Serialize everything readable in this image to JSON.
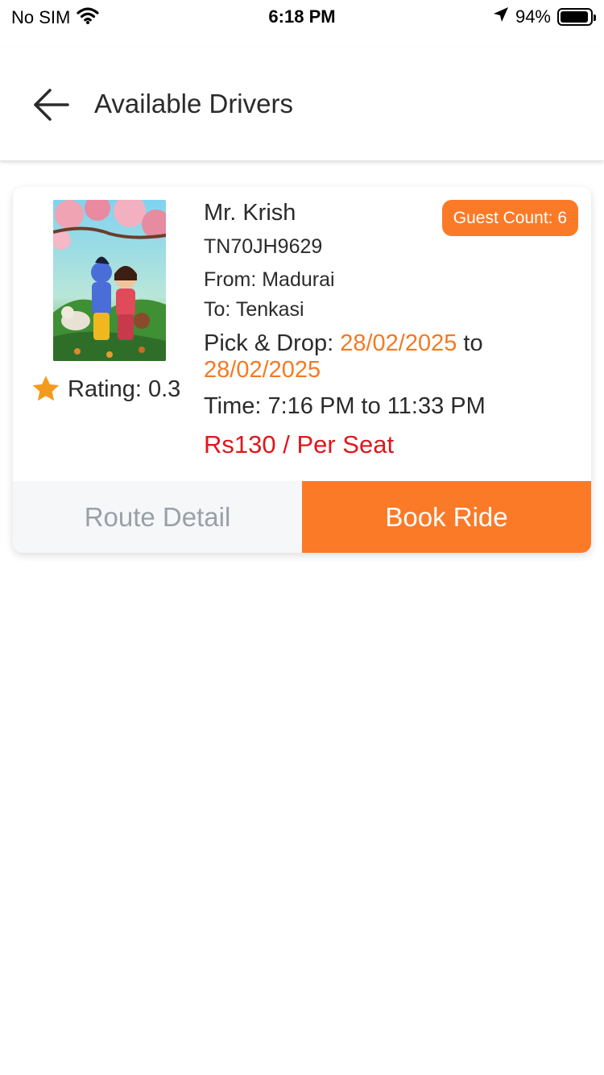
{
  "status_bar": {
    "carrier": "No SIM",
    "time": "6:18 PM",
    "battery": "94%",
    "battery_level": 0.94,
    "icons": [
      "wifi-icon",
      "location-arrow-icon",
      "battery-icon"
    ]
  },
  "header": {
    "title": "Available Drivers",
    "back_icon": "arrow-left-icon"
  },
  "driver": {
    "name": "Mr. Krish",
    "vehicle_number": "TN70JH9629",
    "from": "From: Madurai",
    "to": "To: Tenkasi",
    "pick_drop_label": "Pick & Drop: ",
    "pick_date": "28/02/2025",
    "to_word": " to",
    "drop_date": "28/02/2025",
    "time": "Time: 7:16 PM to 11:33 PM",
    "price": "Rs130 / Per Seat",
    "rating": "Rating: 0.3",
    "guest_count": "Guest Count: 6",
    "avatar_icon": "driver-photo",
    "rating_icon": "star-icon"
  },
  "actions": {
    "route_detail": "Route Detail",
    "book_ride": "Book Ride"
  },
  "colors": {
    "accent": "#fb7a28",
    "date": "#f37a23",
    "price": "#e0161d",
    "muted_button_bg": "#f6f7f9",
    "muted_button_text": "#9aa0a8"
  }
}
